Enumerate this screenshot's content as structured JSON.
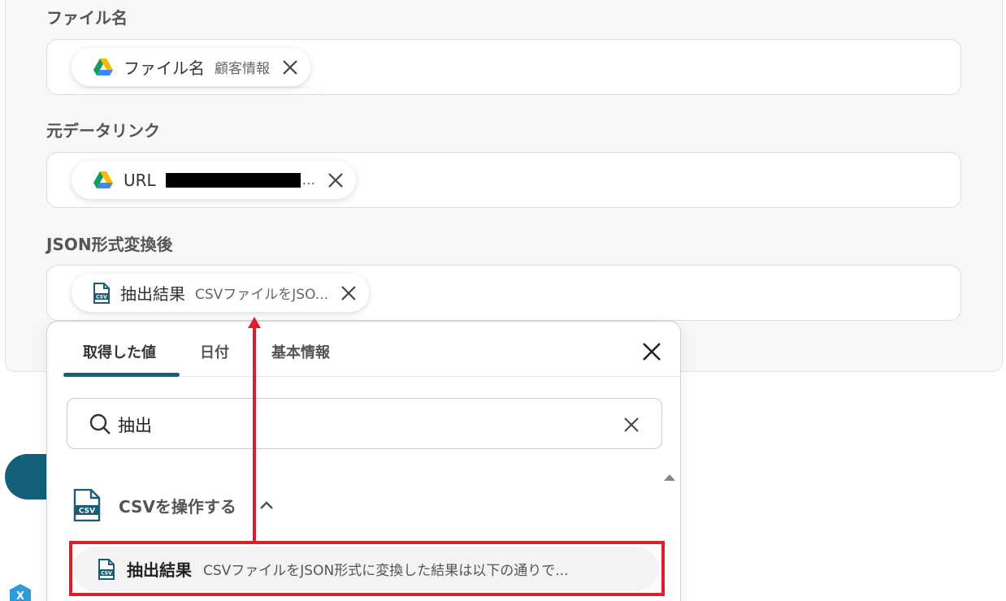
{
  "fields": [
    {
      "label": "ファイル名",
      "chip": {
        "icon": "google-drive-icon",
        "main": "ファイル名",
        "sub": "顧客情報"
      }
    },
    {
      "label": "元データリンク",
      "chip": {
        "icon": "google-drive-icon",
        "main": "URL",
        "sub": "..."
      }
    },
    {
      "label": "JSON形式変換後",
      "chip": {
        "icon": "csv-file-icon",
        "main": "抽出結果",
        "sub": "CSVファイルをJSO..."
      }
    }
  ],
  "dropdown": {
    "tabs": [
      "取得した値",
      "日付",
      "基本情報"
    ],
    "active_tab": "取得した値",
    "search": {
      "value": "抽出"
    },
    "group": {
      "label": "CSVを操作する",
      "icon": "csv-file-icon",
      "expanded": true
    },
    "result": {
      "main": "抽出結果",
      "sub": "CSVファイルをJSON形式に変換した結果は以下の通りで..."
    }
  },
  "colors": {
    "accent": "#12607a",
    "annotation": "#e01e2a"
  }
}
